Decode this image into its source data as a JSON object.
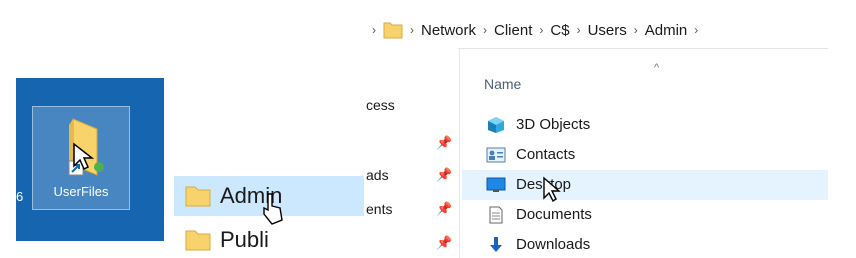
{
  "desktop": {
    "edge_label": "6",
    "item_label": "UserFiles"
  },
  "nav_pane": {
    "items": [
      {
        "label": "Admin",
        "selected": true
      },
      {
        "label": "Publi",
        "selected": false
      }
    ]
  },
  "explorer": {
    "breadcrumb": [
      "Network",
      "Client",
      "C$",
      "Users",
      "Admin"
    ],
    "quick_access": [
      {
        "label": "cess",
        "pinned": false
      },
      {
        "label": "",
        "pinned": true
      },
      {
        "label": "ads",
        "pinned": true
      },
      {
        "label": "ents",
        "pinned": true
      }
    ],
    "column_header": "Name",
    "files": [
      {
        "name": "3D Objects",
        "icon": "3d-objects-icon"
      },
      {
        "name": "Contacts",
        "icon": "contacts-icon"
      },
      {
        "name": "Desktop",
        "icon": "desktop-folder-icon",
        "hover": true
      },
      {
        "name": "Documents",
        "icon": "documents-icon"
      },
      {
        "name": "Downloads",
        "icon": "downloads-icon"
      }
    ]
  },
  "colors": {
    "desktop_bg": "#1565b0",
    "selection": "#cce8ff",
    "hover": "#e5f3ff",
    "folder_yellow": "#f8d36b"
  }
}
